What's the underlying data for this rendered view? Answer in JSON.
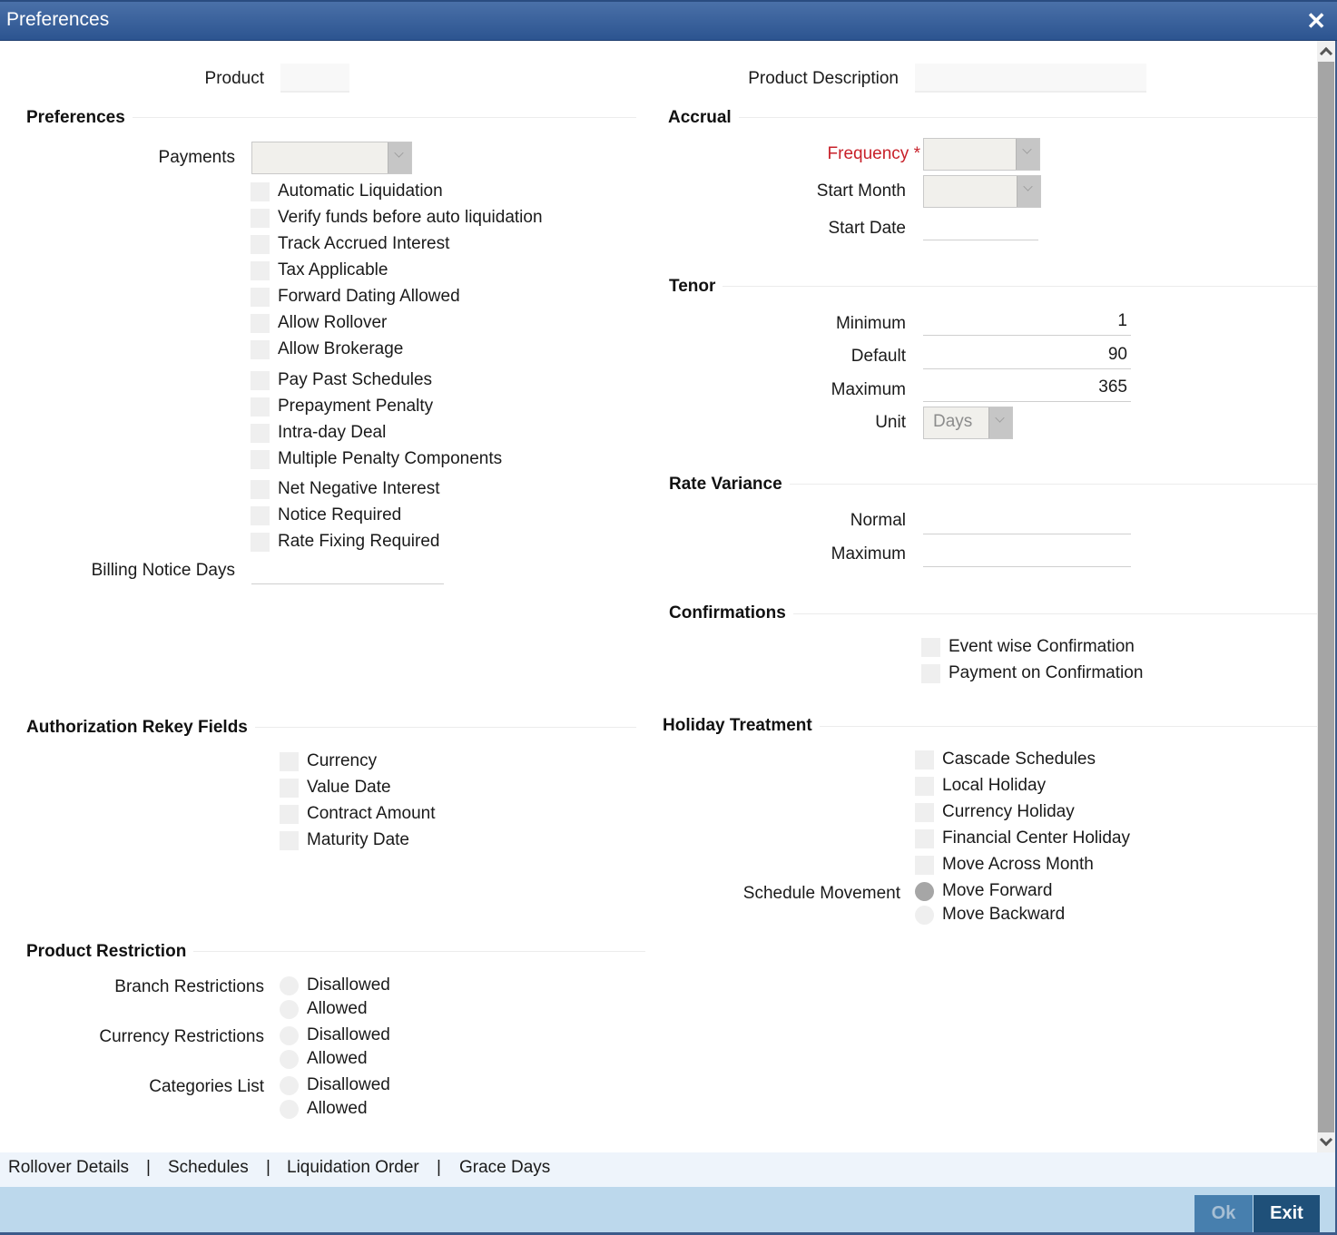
{
  "window": {
    "title": "Preferences",
    "close_icon": "close-icon"
  },
  "header": {
    "product_label": "Product",
    "product_value": "",
    "product_description_label": "Product Description",
    "product_description_value": ""
  },
  "preferences": {
    "title": "Preferences",
    "payments_label": "Payments",
    "payments_value": "",
    "checkboxes": [
      {
        "label": "Automatic Liquidation",
        "checked": false
      },
      {
        "label": "Verify funds before auto liquidation",
        "checked": false
      },
      {
        "label": "Track Accrued Interest",
        "checked": false
      },
      {
        "label": "Tax Applicable",
        "checked": false
      },
      {
        "label": "Forward Dating Allowed",
        "checked": false
      },
      {
        "label": "Allow Rollover",
        "checked": false
      },
      {
        "label": "Allow Brokerage",
        "checked": false
      },
      {
        "label": "Pay Past Schedules",
        "checked": false
      },
      {
        "label": "Prepayment Penalty",
        "checked": false
      },
      {
        "label": "Intra-day Deal",
        "checked": false
      },
      {
        "label": "Multiple Penalty Components",
        "checked": false
      },
      {
        "label": "Net Negative Interest",
        "checked": false
      },
      {
        "label": "Notice Required",
        "checked": false
      },
      {
        "label": "Rate Fixing Required",
        "checked": false
      }
    ],
    "billing_notice_days_label": "Billing Notice Days",
    "billing_notice_days_value": ""
  },
  "accrual": {
    "title": "Accrual",
    "frequency_label": "Frequency",
    "required_marker": "*",
    "frequency_value": "",
    "start_month_label": "Start Month",
    "start_month_value": "",
    "start_date_label": "Start Date",
    "start_date_value": ""
  },
  "tenor": {
    "title": "Tenor",
    "minimum_label": "Minimum",
    "minimum_value": "1",
    "default_label": "Default",
    "default_value": "90",
    "maximum_label": "Maximum",
    "maximum_value": "365",
    "unit_label": "Unit",
    "unit_value": "Days"
  },
  "rate_variance": {
    "title": "Rate Variance",
    "normal_label": "Normal",
    "normal_value": "",
    "maximum_label": "Maximum",
    "maximum_value": ""
  },
  "confirmations": {
    "title": "Confirmations",
    "checkboxes": [
      {
        "label": "Event wise Confirmation",
        "checked": false
      },
      {
        "label": "Payment on Confirmation",
        "checked": false
      }
    ]
  },
  "authorization_rekey": {
    "title": "Authorization Rekey Fields",
    "checkboxes": [
      {
        "label": "Currency",
        "checked": false
      },
      {
        "label": "Value Date",
        "checked": false
      },
      {
        "label": "Contract Amount",
        "checked": false
      },
      {
        "label": "Maturity Date",
        "checked": false
      }
    ]
  },
  "holiday_treatment": {
    "title": "Holiday Treatment",
    "checkboxes": [
      {
        "label": "Cascade Schedules",
        "checked": false
      },
      {
        "label": "Local Holiday",
        "checked": false
      },
      {
        "label": "Currency Holiday",
        "checked": false
      },
      {
        "label": "Financial Center Holiday",
        "checked": false
      },
      {
        "label": "Move Across Month",
        "checked": false
      }
    ],
    "schedule_movement_label": "Schedule Movement",
    "schedule_movement_options": [
      {
        "label": "Move Forward",
        "selected": true
      },
      {
        "label": "Move Backward",
        "selected": false
      }
    ]
  },
  "product_restriction": {
    "title": "Product Restriction",
    "groups": [
      {
        "label": "Branch Restrictions",
        "options": [
          {
            "label": "Disallowed",
            "selected": false
          },
          {
            "label": "Allowed",
            "selected": false
          }
        ]
      },
      {
        "label": "Currency Restrictions",
        "options": [
          {
            "label": "Disallowed",
            "selected": false
          },
          {
            "label": "Allowed",
            "selected": false
          }
        ]
      },
      {
        "label": "Categories List",
        "options": [
          {
            "label": "Disallowed",
            "selected": false
          },
          {
            "label": "Allowed",
            "selected": false
          }
        ]
      }
    ]
  },
  "tabs": {
    "items": [
      "Rollover Details",
      "Schedules",
      "Liquidation Order",
      "Grace Days"
    ],
    "separator": "|"
  },
  "footer": {
    "ok_label": "Ok",
    "exit_label": "Exit"
  },
  "colors": {
    "title_bar": "#2c5490",
    "required": "#c8212a",
    "footer_bg": "#bcd8ec",
    "ok_button": "#477fae",
    "exit_button": "#1f5079"
  }
}
